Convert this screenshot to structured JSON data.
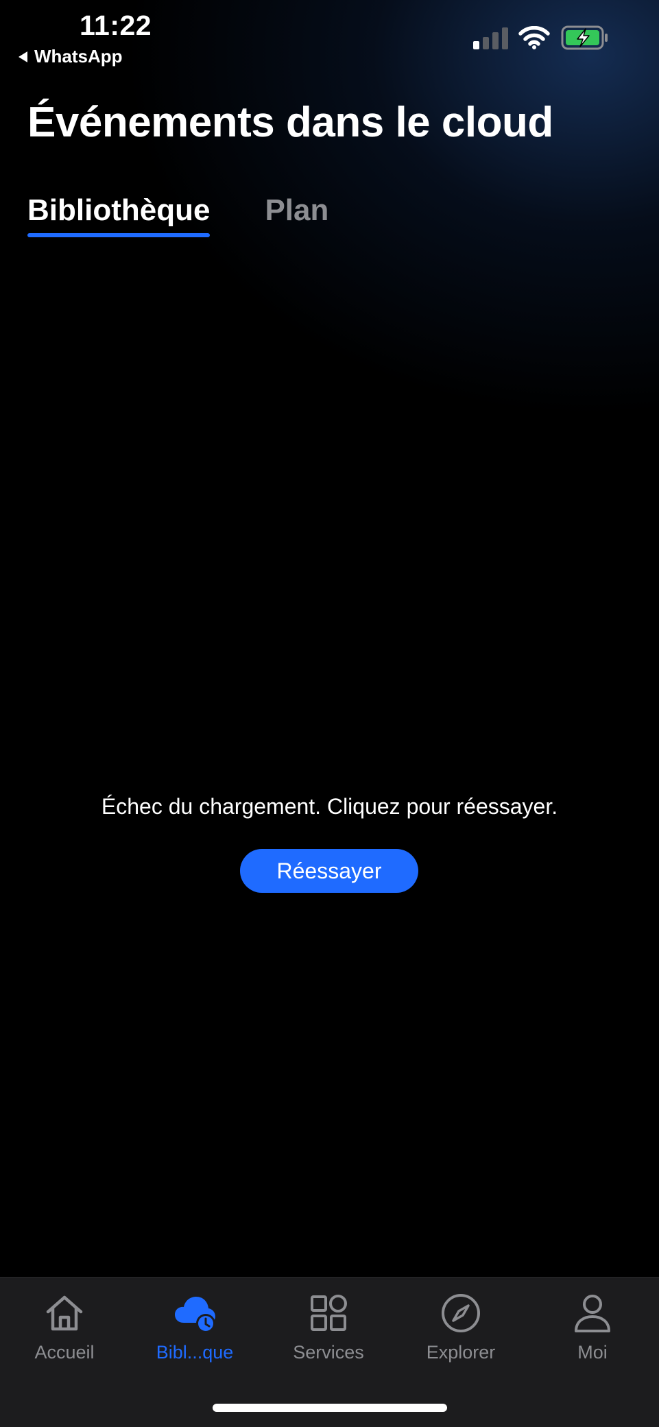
{
  "status_bar": {
    "time": "11:22",
    "back_app": "WhatsApp",
    "signal_bars_active": 1,
    "signal_bars_total": 4,
    "battery_charging": true
  },
  "header": {
    "title": "Événements dans le cloud"
  },
  "tabs": [
    {
      "label": "Bibliothèque",
      "active": true
    },
    {
      "label": "Plan",
      "active": false
    }
  ],
  "main": {
    "error_message": "Échec du chargement. Cliquez pour réessayer.",
    "retry_label": "Réessayer"
  },
  "nav": {
    "items": [
      {
        "label": "Accueil",
        "icon": "home-icon",
        "active": false
      },
      {
        "label": "Bibl...que",
        "icon": "cloud-clock-icon",
        "active": true
      },
      {
        "label": "Services",
        "icon": "grid-icon",
        "active": false
      },
      {
        "label": "Explorer",
        "icon": "compass-icon",
        "active": false
      },
      {
        "label": "Moi",
        "icon": "person-icon",
        "active": false
      }
    ]
  },
  "colors": {
    "accent": "#1f6bff",
    "inactive": "#8d8e92",
    "battery_green": "#34c759",
    "nav_background": "#1c1c1e"
  }
}
